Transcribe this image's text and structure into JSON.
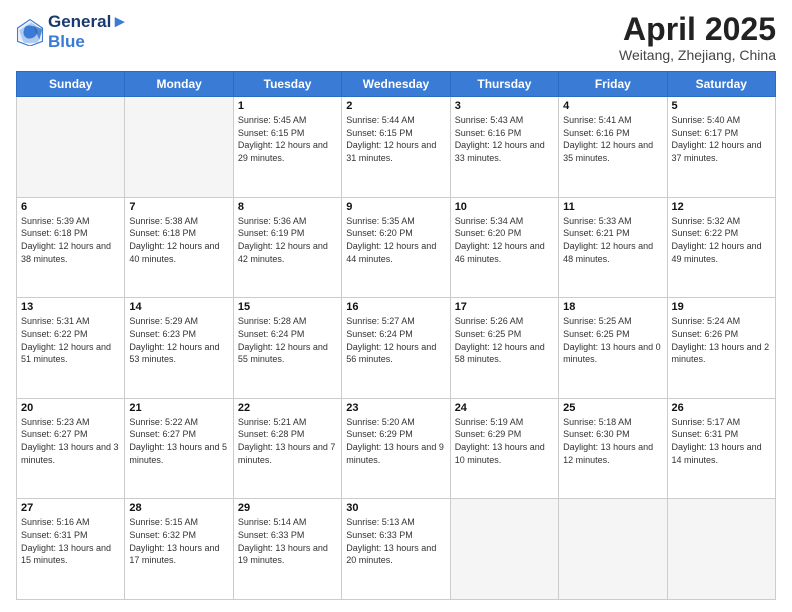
{
  "logo": {
    "line1": "General",
    "line2": "Blue"
  },
  "title": "April 2025",
  "location": "Weitang, Zhejiang, China",
  "weekdays": [
    "Sunday",
    "Monday",
    "Tuesday",
    "Wednesday",
    "Thursday",
    "Friday",
    "Saturday"
  ],
  "days": [
    {
      "num": "",
      "info": ""
    },
    {
      "num": "",
      "info": ""
    },
    {
      "num": "1",
      "sunrise": "5:45 AM",
      "sunset": "6:15 PM",
      "daylight": "12 hours and 29 minutes."
    },
    {
      "num": "2",
      "sunrise": "5:44 AM",
      "sunset": "6:15 PM",
      "daylight": "12 hours and 31 minutes."
    },
    {
      "num": "3",
      "sunrise": "5:43 AM",
      "sunset": "6:16 PM",
      "daylight": "12 hours and 33 minutes."
    },
    {
      "num": "4",
      "sunrise": "5:41 AM",
      "sunset": "6:16 PM",
      "daylight": "12 hours and 35 minutes."
    },
    {
      "num": "5",
      "sunrise": "5:40 AM",
      "sunset": "6:17 PM",
      "daylight": "12 hours and 37 minutes."
    },
    {
      "num": "6",
      "sunrise": "5:39 AM",
      "sunset": "6:18 PM",
      "daylight": "12 hours and 38 minutes."
    },
    {
      "num": "7",
      "sunrise": "5:38 AM",
      "sunset": "6:18 PM",
      "daylight": "12 hours and 40 minutes."
    },
    {
      "num": "8",
      "sunrise": "5:36 AM",
      "sunset": "6:19 PM",
      "daylight": "12 hours and 42 minutes."
    },
    {
      "num": "9",
      "sunrise": "5:35 AM",
      "sunset": "6:20 PM",
      "daylight": "12 hours and 44 minutes."
    },
    {
      "num": "10",
      "sunrise": "5:34 AM",
      "sunset": "6:20 PM",
      "daylight": "12 hours and 46 minutes."
    },
    {
      "num": "11",
      "sunrise": "5:33 AM",
      "sunset": "6:21 PM",
      "daylight": "12 hours and 48 minutes."
    },
    {
      "num": "12",
      "sunrise": "5:32 AM",
      "sunset": "6:22 PM",
      "daylight": "12 hours and 49 minutes."
    },
    {
      "num": "13",
      "sunrise": "5:31 AM",
      "sunset": "6:22 PM",
      "daylight": "12 hours and 51 minutes."
    },
    {
      "num": "14",
      "sunrise": "5:29 AM",
      "sunset": "6:23 PM",
      "daylight": "12 hours and 53 minutes."
    },
    {
      "num": "15",
      "sunrise": "5:28 AM",
      "sunset": "6:24 PM",
      "daylight": "12 hours and 55 minutes."
    },
    {
      "num": "16",
      "sunrise": "5:27 AM",
      "sunset": "6:24 PM",
      "daylight": "12 hours and 56 minutes."
    },
    {
      "num": "17",
      "sunrise": "5:26 AM",
      "sunset": "6:25 PM",
      "daylight": "12 hours and 58 minutes."
    },
    {
      "num": "18",
      "sunrise": "5:25 AM",
      "sunset": "6:25 PM",
      "daylight": "13 hours and 0 minutes."
    },
    {
      "num": "19",
      "sunrise": "5:24 AM",
      "sunset": "6:26 PM",
      "daylight": "13 hours and 2 minutes."
    },
    {
      "num": "20",
      "sunrise": "5:23 AM",
      "sunset": "6:27 PM",
      "daylight": "13 hours and 3 minutes."
    },
    {
      "num": "21",
      "sunrise": "5:22 AM",
      "sunset": "6:27 PM",
      "daylight": "13 hours and 5 minutes."
    },
    {
      "num": "22",
      "sunrise": "5:21 AM",
      "sunset": "6:28 PM",
      "daylight": "13 hours and 7 minutes."
    },
    {
      "num": "23",
      "sunrise": "5:20 AM",
      "sunset": "6:29 PM",
      "daylight": "13 hours and 9 minutes."
    },
    {
      "num": "24",
      "sunrise": "5:19 AM",
      "sunset": "6:29 PM",
      "daylight": "13 hours and 10 minutes."
    },
    {
      "num": "25",
      "sunrise": "5:18 AM",
      "sunset": "6:30 PM",
      "daylight": "13 hours and 12 minutes."
    },
    {
      "num": "26",
      "sunrise": "5:17 AM",
      "sunset": "6:31 PM",
      "daylight": "13 hours and 14 minutes."
    },
    {
      "num": "27",
      "sunrise": "5:16 AM",
      "sunset": "6:31 PM",
      "daylight": "13 hours and 15 minutes."
    },
    {
      "num": "28",
      "sunrise": "5:15 AM",
      "sunset": "6:32 PM",
      "daylight": "13 hours and 17 minutes."
    },
    {
      "num": "29",
      "sunrise": "5:14 AM",
      "sunset": "6:33 PM",
      "daylight": "13 hours and 19 minutes."
    },
    {
      "num": "30",
      "sunrise": "5:13 AM",
      "sunset": "6:33 PM",
      "daylight": "13 hours and 20 minutes."
    },
    {
      "num": "",
      "info": ""
    },
    {
      "num": "",
      "info": ""
    },
    {
      "num": "",
      "info": ""
    },
    {
      "num": "",
      "info": ""
    }
  ]
}
